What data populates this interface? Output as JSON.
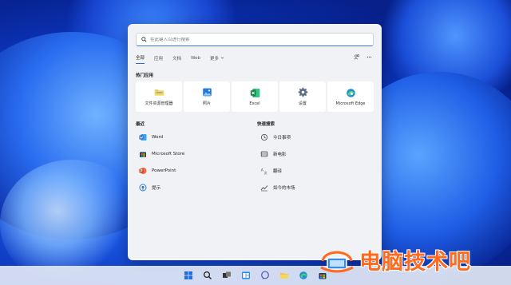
{
  "search": {
    "placeholder": "在此键入以进行搜索"
  },
  "tabs": [
    {
      "label": "全部",
      "active": true
    },
    {
      "label": "应用"
    },
    {
      "label": "文档"
    },
    {
      "label": "Web"
    },
    {
      "label": "更多"
    }
  ],
  "top_section": {
    "title": "热门应用",
    "apps": [
      {
        "label": "文件资源管理器",
        "icon": "folder-icon"
      },
      {
        "label": "照片",
        "icon": "photos-icon"
      },
      {
        "label": "Excel",
        "icon": "excel-icon"
      },
      {
        "label": "设置",
        "icon": "gear-icon"
      },
      {
        "label": "Microsoft Edge",
        "icon": "edge-icon"
      }
    ]
  },
  "recent": {
    "title": "最近",
    "items": [
      {
        "label": "Word",
        "icon": "word-icon"
      },
      {
        "label": "Microsoft Store",
        "icon": "store-icon"
      },
      {
        "label": "PowerPoint",
        "icon": "powerpoint-icon"
      },
      {
        "label": "提示",
        "icon": "tips-icon"
      }
    ]
  },
  "quick_search": {
    "title": "快速搜索",
    "items": [
      {
        "label": "今日事项",
        "icon": "clock-icon"
      },
      {
        "label": "新电影",
        "icon": "film-icon"
      },
      {
        "label": "翻译",
        "icon": "translate-icon"
      },
      {
        "label": "如今的市场",
        "icon": "market-icon"
      }
    ]
  },
  "taskbar": {
    "icons": [
      "windows-start-icon",
      "search-icon",
      "task-view-icon",
      "widgets-icon",
      "chat-icon",
      "file-explorer-icon",
      "edge-icon",
      "store-icon"
    ]
  },
  "watermark": {
    "text": "电脑技术吧"
  },
  "colors": {
    "accent": "#2f63d8",
    "panel": "#f1f2f6",
    "watermark": "#ff6a1f"
  }
}
